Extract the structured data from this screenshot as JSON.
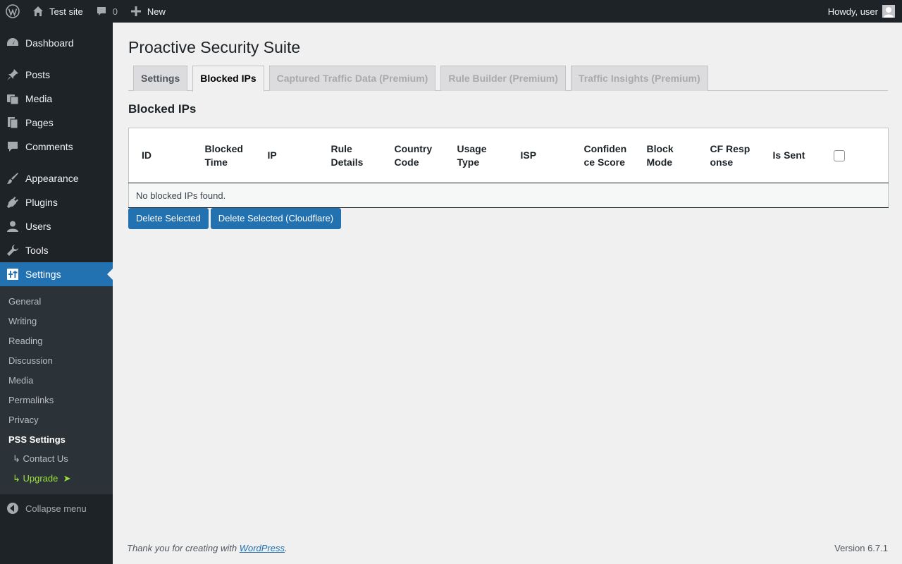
{
  "adminbar": {
    "site_name": "Test site",
    "comments_count": "0",
    "new_label": "New",
    "greeting": "Howdy, user"
  },
  "sidebar": {
    "items": [
      {
        "label": "Dashboard",
        "icon": "dashboard-icon"
      },
      {
        "label": "Posts",
        "icon": "pin-icon"
      },
      {
        "label": "Media",
        "icon": "media-icon"
      },
      {
        "label": "Pages",
        "icon": "pages-icon"
      },
      {
        "label": "Comments",
        "icon": "comment-icon"
      },
      {
        "label": "Appearance",
        "icon": "brush-icon"
      },
      {
        "label": "Plugins",
        "icon": "plug-icon"
      },
      {
        "label": "Users",
        "icon": "user-icon"
      },
      {
        "label": "Tools",
        "icon": "wrench-icon"
      },
      {
        "label": "Settings",
        "icon": "settings-icon"
      }
    ],
    "settings_submenu": [
      "General",
      "Writing",
      "Reading",
      "Discussion",
      "Media",
      "Permalinks",
      "Privacy",
      "PSS Settings",
      "↳ Contact Us",
      "↳ Upgrade  ➤"
    ],
    "collapse_label": "Collapse menu"
  },
  "main": {
    "title": "Proactive Security Suite",
    "tabs": [
      "Settings",
      "Blocked IPs",
      "Captured Traffic Data (Premium)",
      "Rule Builder (Premium)",
      "Traffic Insights (Premium)"
    ],
    "section_title": "Blocked IPs",
    "table": {
      "columns": [
        "ID",
        "Blocked Time",
        "IP",
        "Rule Details",
        "Country Code",
        "Usage Type",
        "ISP",
        "Confidence Score",
        "Block Mode",
        "CF Response",
        "Is Sent"
      ],
      "empty_message": "No blocked IPs found."
    },
    "buttons": {
      "delete_selected": "Delete Selected",
      "delete_selected_cf": "Delete Selected (Cloudflare)"
    }
  },
  "footer": {
    "thanks_prefix": "Thank you for creating with ",
    "thanks_link": "WordPress",
    "thanks_suffix": ".",
    "version": "Version 6.7.1"
  },
  "colors": {
    "admin_dark": "#1d2327",
    "accent_blue": "#2271b1",
    "upgrade_green": "#9be33b"
  }
}
